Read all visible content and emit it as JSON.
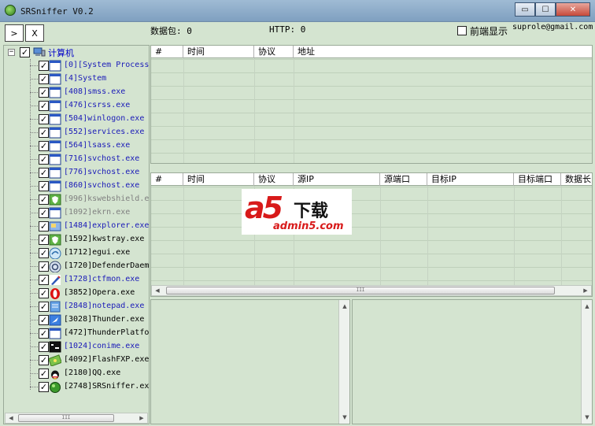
{
  "window": {
    "title": "SRSniffer V0.2",
    "min_label": "▭",
    "max_label": "☐",
    "close_label": "✕"
  },
  "toolbar": {
    "start_label": ">",
    "stop_label": "X",
    "packets_text": "数据包: 0",
    "http_text": "HTTP: 0",
    "foreground_label": "前端显示",
    "email": "suprole@gmail.com"
  },
  "tree": {
    "root_label": "计算机",
    "root_checked": "✓",
    "processes": [
      {
        "label": "[0][System Process",
        "color": "blue",
        "icon": "window-icon"
      },
      {
        "label": "[4]System",
        "color": "blue",
        "icon": "window-icon"
      },
      {
        "label": "[408]smss.exe",
        "color": "blue",
        "icon": "window-icon"
      },
      {
        "label": "[476]csrss.exe",
        "color": "blue",
        "icon": "window-icon"
      },
      {
        "label": "[504]winlogon.exe",
        "color": "blue",
        "icon": "window-icon"
      },
      {
        "label": "[552]services.exe",
        "color": "blue",
        "icon": "window-icon"
      },
      {
        "label": "[564]lsass.exe",
        "color": "blue",
        "icon": "window-icon"
      },
      {
        "label": "[716]svchost.exe",
        "color": "blue",
        "icon": "window-icon"
      },
      {
        "label": "[776]svchost.exe",
        "color": "blue",
        "icon": "window-icon"
      },
      {
        "label": "[860]svchost.exe",
        "color": "blue",
        "icon": "window-icon"
      },
      {
        "label": "[996]kswebshield.e",
        "color": "gray",
        "icon": "shield-icon"
      },
      {
        "label": "[1092]ekrn.exe",
        "color": "gray",
        "icon": "window-icon"
      },
      {
        "label": "[1484]explorer.exe",
        "color": "blue",
        "icon": "explorer-icon"
      },
      {
        "label": "[1592]kwstray.exe",
        "color": "black",
        "icon": "shield-icon"
      },
      {
        "label": "[1712]egui.exe",
        "color": "black",
        "icon": "eset-icon"
      },
      {
        "label": "[1720]DefenderDaem",
        "color": "black",
        "icon": "defender-icon"
      },
      {
        "label": "[1728]ctfmon.exe",
        "color": "blue",
        "icon": "pen-icon"
      },
      {
        "label": "[3852]Opera.exe",
        "color": "black",
        "icon": "opera-icon"
      },
      {
        "label": "[2848]notepad.exe",
        "color": "blue",
        "icon": "notepad-icon"
      },
      {
        "label": "[3028]Thunder.exe",
        "color": "black",
        "icon": "thunder-icon"
      },
      {
        "label": "[472]ThunderPlatfo",
        "color": "black",
        "icon": "window-icon"
      },
      {
        "label": "[1024]conime.exe",
        "color": "blue",
        "icon": "console-icon"
      },
      {
        "label": "[4092]FlashFXP.exe",
        "color": "black",
        "icon": "flashfxp-icon"
      },
      {
        "label": "[2180]QQ.exe",
        "color": "black",
        "icon": "qq-icon"
      },
      {
        "label": "[2748]SRSniffer.ex",
        "color": "black",
        "icon": "srsniffer-icon"
      }
    ]
  },
  "grid_top": {
    "columns": [
      "#",
      "时间",
      "协议",
      "地址"
    ]
  },
  "grid_mid": {
    "columns": [
      "#",
      "时间",
      "协议",
      "源IP",
      "源端口",
      "目标IP",
      "目标端口",
      "数据长"
    ]
  },
  "scroll": {
    "thumb_grip": "III",
    "left_arrow": "◀",
    "right_arrow": "▶",
    "up_arrow": "▲",
    "down_arrow": "▼"
  },
  "watermark": {
    "logo": "a5",
    "cn": "下载",
    "url": "admin5.com"
  },
  "colors": {
    "background": "#d4e4d0",
    "blue_text": "#1a1ab8",
    "gray_text": "#808080"
  }
}
